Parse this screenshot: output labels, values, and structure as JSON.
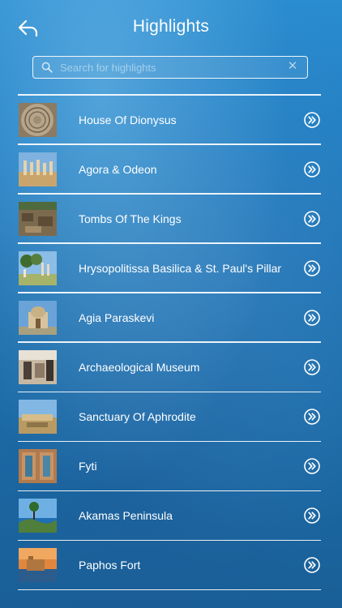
{
  "header": {
    "title": "Highlights",
    "back_icon": "back-arrow-icon"
  },
  "search": {
    "placeholder": "Search for highlights",
    "value": "",
    "search_icon": "search-icon",
    "clear_icon": "clear-icon",
    "clear_glyph": "✕"
  },
  "highlights": [
    {
      "label": "House Of Dionysus",
      "thumb": "mosaic"
    },
    {
      "label": "Agora & Odeon",
      "thumb": "ruins"
    },
    {
      "label": "Tombs Of The Kings",
      "thumb": "tombs"
    },
    {
      "label": "Hrysopolitissa Basilica & St. Paul's Pillar",
      "thumb": "basilica"
    },
    {
      "label": "Agia Paraskevi",
      "thumb": "church"
    },
    {
      "label": "Archaeological Museum",
      "thumb": "museum"
    },
    {
      "label": "Sanctuary Of Aphrodite",
      "thumb": "sanctuary"
    },
    {
      "label": "Fyti",
      "thumb": "doorway"
    },
    {
      "label": "Akamas Peninsula",
      "thumb": "coast"
    },
    {
      "label": "Paphos Fort",
      "thumb": "fort"
    }
  ],
  "row_action_icon": "chevron-right-circle-icon",
  "colors": {
    "background": "#1f78bb",
    "text": "#ffffff"
  }
}
